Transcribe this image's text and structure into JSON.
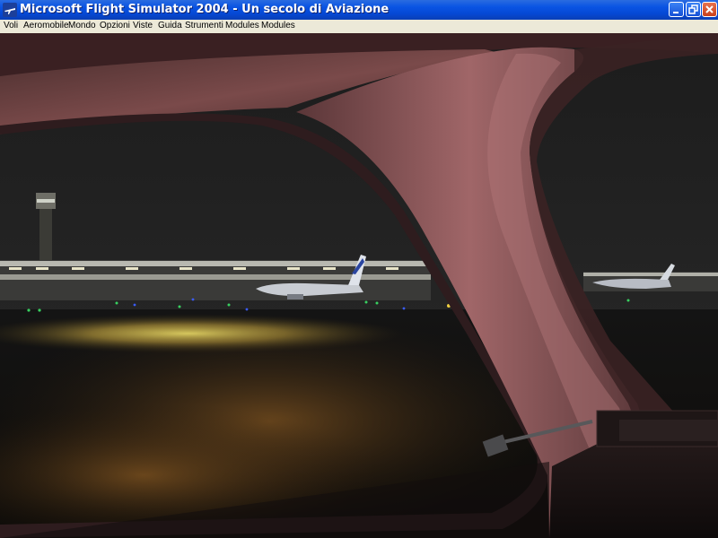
{
  "window": {
    "title": "Microsoft Flight Simulator 2004 - Un secolo di Aviazione",
    "icon": "flight-sim-app-icon",
    "controls": [
      "minimize-icon",
      "restore-icon",
      "close-icon"
    ]
  },
  "menu": {
    "items": [
      {
        "label": "Voli"
      },
      {
        "label": "Aeromobile"
      },
      {
        "label": "Mondo"
      },
      {
        "label": "Opzioni"
      },
      {
        "label": "Viste"
      },
      {
        "label": "Guida"
      },
      {
        "label": "Strumenti"
      },
      {
        "label": "Modules"
      },
      {
        "label": "Modules"
      }
    ]
  },
  "colors": {
    "titlebar": "#0a54e3",
    "menubar": "#ece9d8",
    "cockpit_frame": "#6b3f40",
    "night_sky": "#232323",
    "runway_light": "#e8d04a"
  }
}
